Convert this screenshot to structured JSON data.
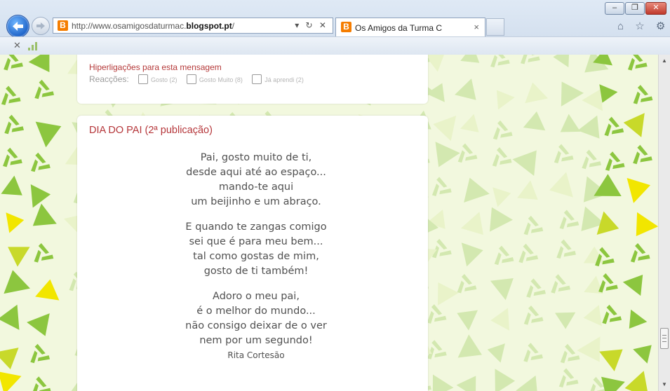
{
  "browser": {
    "url_prefix": "http://www.osamigosdaturmac.",
    "url_domain": "blogspot.pt",
    "url_suffix": "/",
    "address_buttons": "▾ ↻ ✕",
    "tab_title": "Os Amigos da Turma C",
    "tab_close": "×",
    "favicon_letter": "B",
    "window_buttons": {
      "minimize": "–",
      "maximize": "❐",
      "close": "✕"
    },
    "toolbar_icons": [
      "home-icon",
      "star-icon",
      "gear-icon"
    ],
    "toolbar_glyphs": "⌂ ☆ ⚙",
    "cmd_close": "✕"
  },
  "post_prev": {
    "links_label": "Hiperligações para esta mensagem",
    "reactions_label": "Reacções:",
    "reactions": [
      {
        "label": "Gosto (2)"
      },
      {
        "label": "Gosto Muito (8)"
      },
      {
        "label": "Já aprendi (2)"
      }
    ]
  },
  "post": {
    "title": "DIA DO PAI (2ª publicação)",
    "stanzas": [
      [
        "Pai, gosto muito de ti,",
        "desde aqui até ao espaço...",
        "mando-te aqui",
        "um beijinho e um abraço."
      ],
      [
        "E quando te zangas comigo",
        "sei que é para meu bem...",
        "tal como gostas de mim,",
        "gosto de ti também!"
      ],
      [
        "Adoro o meu pai,",
        "é o melhor do mundo...",
        "não consigo deixar de o ver",
        "nem por um segundo!"
      ]
    ],
    "author": "Rita Cortesão"
  },
  "colors": {
    "title_red": "#b5363a",
    "background_greens": [
      "#8cc63f",
      "#c8d92a",
      "#f2e600",
      "#d3e8b0",
      "#e9f3c9"
    ]
  }
}
